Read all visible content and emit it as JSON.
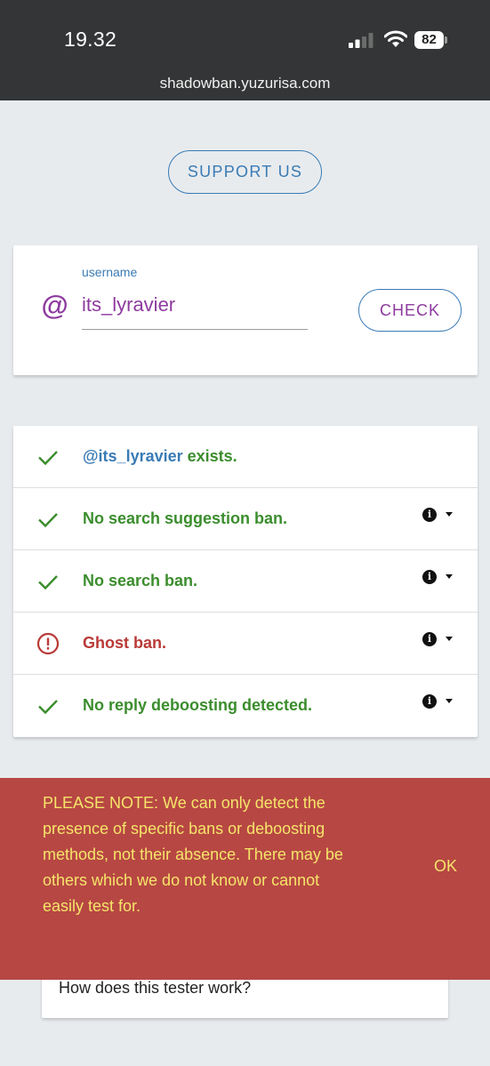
{
  "statusbar": {
    "time": "19.32",
    "battery": "82",
    "url": "shadowban.yuzurisa.com",
    "icons": [
      "signal-icon",
      "wifi-icon",
      "battery-icon"
    ]
  },
  "support_button": "SUPPORT US",
  "form": {
    "at_symbol": "@",
    "label": "username",
    "value": "its_lyravier",
    "check_button": "CHECK"
  },
  "results": [
    {
      "status": "ok",
      "icon": "check-icon",
      "prefix": "@its_lyravier",
      "text": " exists.",
      "has_info": false
    },
    {
      "status": "ok",
      "icon": "check-icon",
      "text": "No search suggestion ban.",
      "has_info": true
    },
    {
      "status": "ok",
      "icon": "check-icon",
      "text": "No search ban.",
      "has_info": true
    },
    {
      "status": "ban",
      "icon": "alert-circle-icon",
      "text": "Ghost ban.",
      "has_info": true
    },
    {
      "status": "ok",
      "icon": "check-icon",
      "text": "No reply deboosting detected.",
      "has_info": true
    }
  ],
  "info_glyph": "i",
  "how_card": "How does this tester work?",
  "snackbar": {
    "message": "PLEASE NOTE: We can only detect the presence of specific bans or deboosting methods, not their absence. There may be others which we do not know or cannot easily test for.",
    "ok": "OK"
  },
  "colors": {
    "ok": "#3b8d2d",
    "ban": "#b83a37",
    "accent_blue": "#3a7bb5",
    "accent_purple": "#8e3a9f",
    "snackbar_bg": "#b74743",
    "snackbar_text": "#f6e46a"
  }
}
